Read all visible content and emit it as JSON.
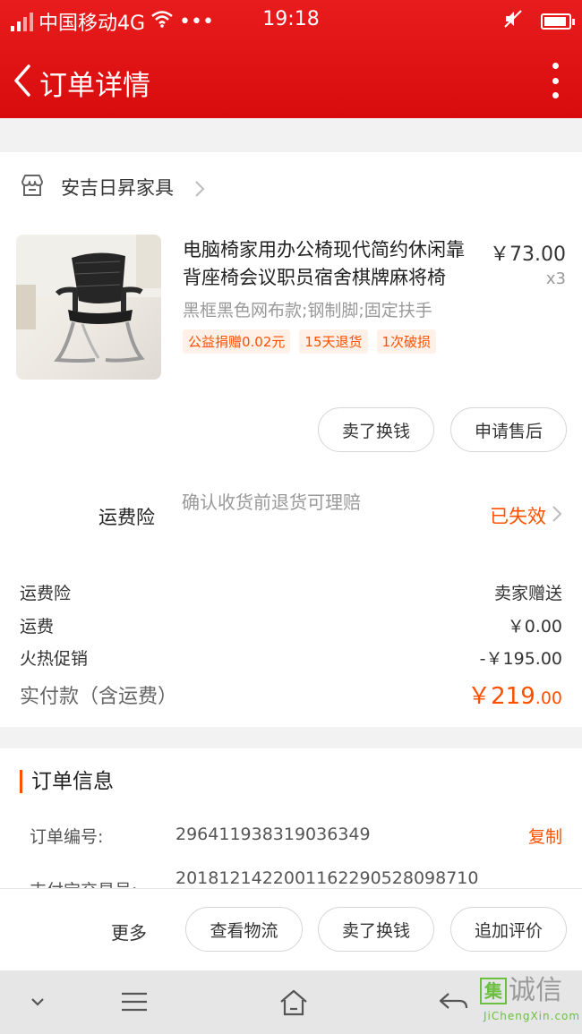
{
  "status_bar": {
    "carrier": "中国移动4G",
    "dots": "•••",
    "time": "19:18"
  },
  "nav": {
    "title": "订单详情"
  },
  "shop": {
    "name": "安吉日昇家具"
  },
  "product": {
    "title": "电脑椅家用办公椅现代简约休闲靠背座椅会议职员宿舍棋牌麻将椅",
    "price": "￥73.00",
    "quantity": "x3",
    "spec": "黑框黑色网布款;钢制脚;固定扶手",
    "tags": [
      "公益捐赠0.02元",
      "15天退货",
      "1次破损"
    ]
  },
  "item_actions": {
    "sell": "卖了换钱",
    "after_sale": "申请售后"
  },
  "insurance": {
    "label": "运费险",
    "description": "确认收货前退货可理赔",
    "status": "已失效"
  },
  "fees": [
    {
      "label": "运费险",
      "value": "卖家赠送"
    },
    {
      "label": "运费",
      "value": "￥0.00"
    },
    {
      "label": "火热促销",
      "value": "-￥195.00"
    }
  ],
  "total": {
    "label": "实付款（含运费）",
    "currency": "￥",
    "integer": "219",
    "cents": ".00"
  },
  "order_info": {
    "title": "订单信息",
    "order_no_label": "订单编号:",
    "order_no": "296411938319036349",
    "copy": "复制",
    "trade_no_label": "支付宝交易号:",
    "trade_no": "2018121422001162290528098710"
  },
  "bottom_actions": {
    "more": "更多",
    "logistics": "查看物流",
    "sell": "卖了换钱",
    "review": "追加评价"
  },
  "watermark": {
    "box": "集",
    "text": "诚信",
    "url": "JiChengXin.com"
  },
  "colors": {
    "header": "#e0141a",
    "accent": "#ff5000"
  }
}
